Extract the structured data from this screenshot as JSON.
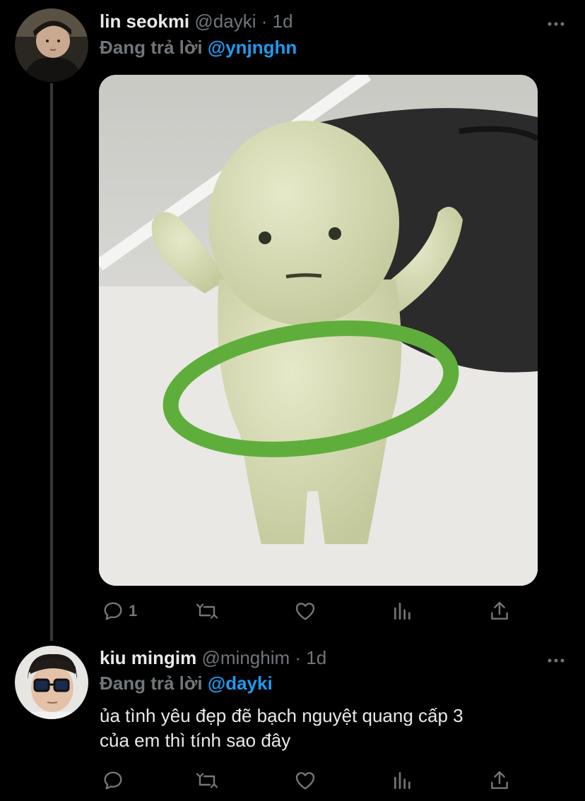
{
  "tweets": [
    {
      "name": "lin seokmi",
      "handle": "@dayki",
      "separator": "·",
      "time": "1d",
      "reply_prefix": "Đang trả lời",
      "reply_to": "@ynjnghn",
      "actions": {
        "reply_count": "1",
        "retweet_count": "",
        "like_count": ""
      }
    },
    {
      "name": "kiu mingim",
      "handle": "@minghim",
      "separator": "·",
      "time": "1d",
      "reply_prefix": "Đang trả lời",
      "reply_to": "@dayki",
      "text_line1": "ủa tình yêu đẹp đẽ bạch nguyệt quang cấp 3",
      "text_line2": "của em thì tính sao đây",
      "actions": {
        "reply_count": "",
        "retweet_count": "",
        "like_count": ""
      }
    }
  ],
  "colors": {
    "background": "#000000",
    "primary_text": "#e7e9ea",
    "secondary_text": "#71767b",
    "accent": "#1d9bf0",
    "icon": "#71767b"
  },
  "icons": {
    "reply": "reply-icon",
    "retweet": "retweet-icon",
    "like": "heart-icon",
    "analytics": "analytics-icon",
    "share": "share-icon",
    "more": "more-icon"
  }
}
